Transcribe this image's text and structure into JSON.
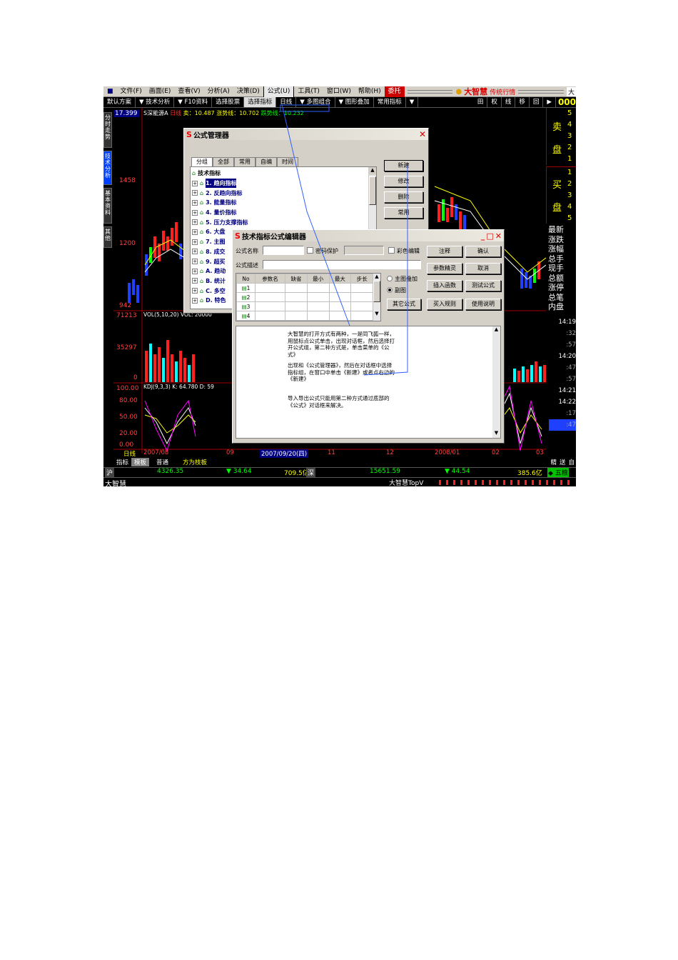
{
  "menubar": {
    "items": [
      "文件(F)",
      "画面(E)",
      "查看(V)",
      "分析(A)",
      "决策(D)",
      "公式(U)",
      "工具(T)",
      "窗口(W)",
      "帮助(H)"
    ],
    "trade_label": "委托",
    "brand": "大智慧",
    "brand_sub": "传统行情",
    "right_text": "大"
  },
  "toolbar": {
    "items": [
      "默认方案",
      "▼ 技术分析",
      "▼ F10资料",
      "选择股票",
      "选择指标",
      "日线",
      "▼ 多图组合",
      "▼ 图形叠加",
      "常用指标",
      "▼"
    ],
    "right_icons": [
      "田",
      "权",
      "线",
      "移",
      "回",
      "▶"
    ],
    "right_number": "000"
  },
  "stock_line": {
    "name": "S深能源A",
    "period": "日线",
    "label1": "卖：",
    "val1": "10.487",
    "label2": "涨势线：",
    "val2": "10.702",
    "label3": "跌势线：",
    "val3": "10.232"
  },
  "sidebar": {
    "tabs": [
      "分时走势",
      "技术分析",
      "基本资料",
      "其他"
    ]
  },
  "price_axis": [
    "17.399",
    "1458",
    "1200",
    "942"
  ],
  "vol_axis": [
    "71213",
    "35297",
    "0"
  ],
  "kdj_axis": [
    "100.00",
    "80.00",
    "50.00",
    "20.00",
    "0.00"
  ],
  "vol_label": "VOL(5,10,20)  VOL: 20000",
  "kdj_label": "KDJ(9,3,3)  K: 64.780  D: 59",
  "right_panel": {
    "sell_label": [
      "卖",
      "盘"
    ],
    "sell_nums": [
      "5",
      "4",
      "3",
      "2",
      "1"
    ],
    "buy_label": [
      "买",
      "盘"
    ],
    "buy_nums": [
      "1",
      "2",
      "3",
      "4",
      "5"
    ],
    "stats": [
      "最新",
      "涨跌",
      "涨幅",
      "总手",
      "现手",
      "总额",
      "涨停",
      "总笔",
      "内盘"
    ],
    "times": [
      "14:19",
      ":32",
      ":57",
      "14:20",
      ":47",
      ":57",
      "14:21",
      "14:22",
      ":17",
      ":47"
    ]
  },
  "date_axis": {
    "label": "日线",
    "d1": "2007/08",
    "d2": "09",
    "current": "2007/09/20(四)",
    "d3": "11",
    "d4": "12",
    "d5": "2008/01",
    "d6": "02",
    "d7": "03"
  },
  "bottom_tabs": [
    "指标",
    "模板",
    "普通",
    "方为枝板"
  ],
  "bottom_right": [
    "精",
    "送",
    "自"
  ],
  "index_bar": {
    "sh_label": "沪",
    "sh_value": "4326.35",
    "sh_change": "▼ 34.64",
    "sh_amount": "709.5亿",
    "sz_label": "深",
    "sz_value": "15651.59",
    "sz_change": "▼ 44.54",
    "sz_amount": "385.6亿",
    "right": "◆ 五粮"
  },
  "statusbar": {
    "left": "大智慧",
    "right": "大智慧TopV"
  },
  "formula_manager": {
    "title": "公式管理器",
    "tabs": [
      "分组",
      "全部",
      "常用",
      "自编",
      "时间"
    ],
    "root": "技术指标",
    "items": [
      "1. 趋向指标",
      "2. 反趋向指标",
      "3. 能量指标",
      "4. 量价指标",
      "5. 压力支撑指标",
      "6. 大盘",
      "7. 主图",
      "8. 成交",
      "9. 超买",
      "A. 趋动",
      "B. 统计",
      "C. 多空",
      "D. 特色"
    ],
    "buttons": [
      "新建",
      "修改",
      "删除",
      "常用"
    ]
  },
  "editor": {
    "title": "技术指标公式编辑器",
    "name_label": "公式名称",
    "password_label": "密码保护",
    "color_label": "彩色编辑",
    "desc_label": "公式描述",
    "columns": [
      "No",
      "参数名",
      "缺省",
      "最小",
      "最大",
      "步长"
    ],
    "rows": [
      "1",
      "2",
      "3",
      "4"
    ],
    "radio1": "主图叠加",
    "radio2": "副图",
    "other_btn": "其它公式",
    "buttons_r1": [
      "注释",
      "确认"
    ],
    "buttons_r2": [
      "参数精灵",
      "取消"
    ],
    "buttons_r3": [
      "插入函数",
      "测试公式"
    ],
    "buttons_r4": [
      "买入规则",
      "使用说明"
    ],
    "text_p1": "大智慧的打开方式有两种，一是同飞狐一样，用鼠标点公式单击，出现对话框，然后选择打开公式组，第二种方式是，单击菜单的《公式》",
    "text_p2": "出现和《公式管理器》，然后在对话框中选择指标组，在窗口中单击《新建》或者点右边的《新建》",
    "text_p3": "导入导出公式只能用第二种方式通过底部的《公式》对话框来解决。"
  },
  "colors": {
    "bg": "#000000",
    "up": "#ff2020",
    "down": "#2040ff",
    "grid": "#800000",
    "dialog": "#d4d0c8",
    "title_bar": "#000080"
  }
}
